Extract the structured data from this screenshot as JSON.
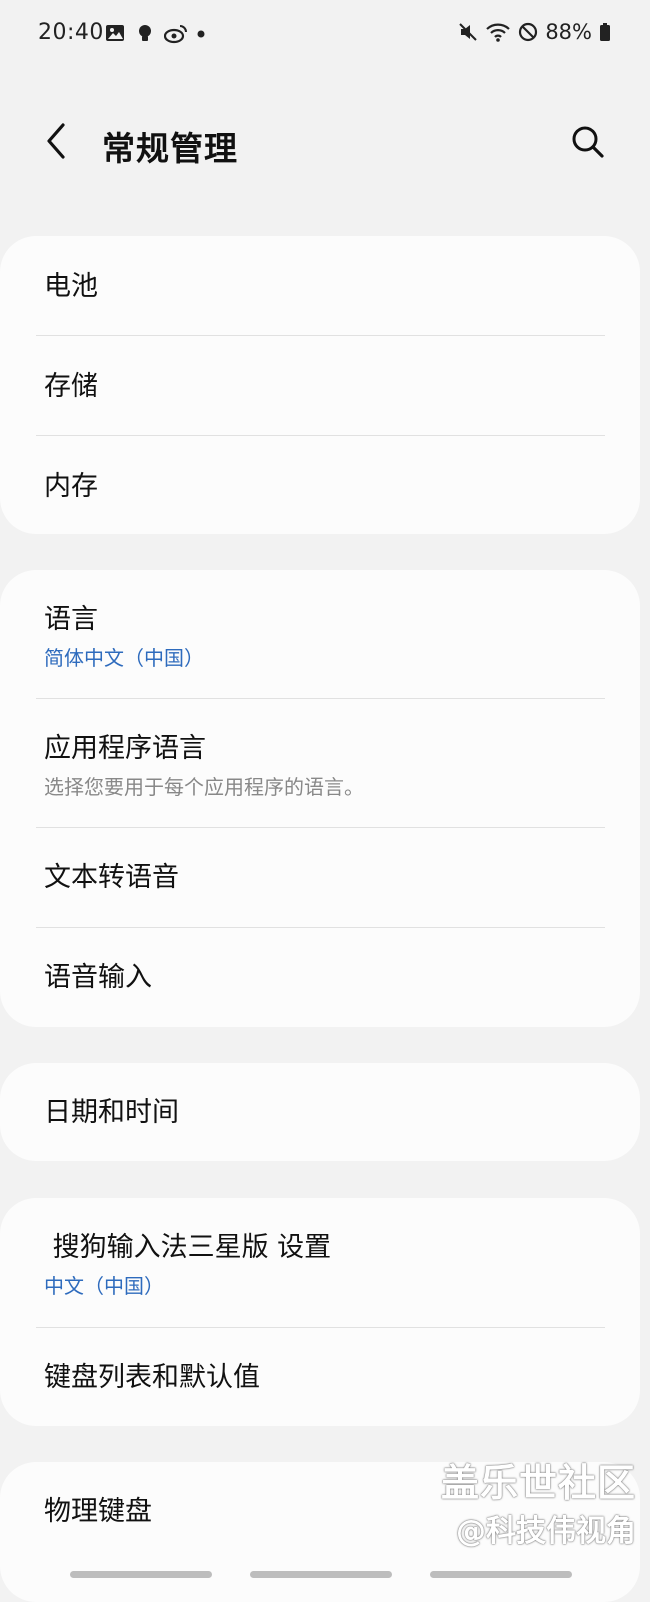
{
  "status_bar": {
    "time": "20:40",
    "battery": "88%",
    "icons": [
      "gallery-icon",
      "bulb-icon",
      "weibo-icon",
      "dot-icon",
      "mute-icon",
      "wifi-icon",
      "dnd-icon",
      "battery-icon"
    ]
  },
  "header": {
    "back_icon": "chevron-left-icon",
    "title": "常规管理",
    "search_icon": "search-icon"
  },
  "groups": [
    {
      "items": [
        {
          "title": "电池"
        },
        {
          "title": "存储"
        },
        {
          "title": "内存"
        }
      ]
    },
    {
      "items": [
        {
          "title": "语言",
          "subtitle": "简体中文（中国）"
        },
        {
          "title": "应用程序语言",
          "subtitle": "选择您要用于每个应用程序的语言。"
        },
        {
          "title": "文本转语音"
        },
        {
          "title": "语音输入"
        }
      ]
    },
    {
      "items": [
        {
          "title": "日期和时间"
        }
      ]
    },
    {
      "items": [
        {
          "title": " 搜狗输入法三星版 设置",
          "subtitle": "中文（中国）"
        },
        {
          "title": "键盘列表和默认值"
        }
      ]
    },
    {
      "items": [
        {
          "title": "物理键盘"
        }
      ]
    }
  ],
  "watermark": {
    "line1": "盖乐世社区",
    "line2": "@科技伟视角"
  },
  "colors": {
    "background": "#f2f2f2",
    "card": "#fcfcfc",
    "accent_blue": "#2e6bbd",
    "secondary_text": "#888888"
  }
}
